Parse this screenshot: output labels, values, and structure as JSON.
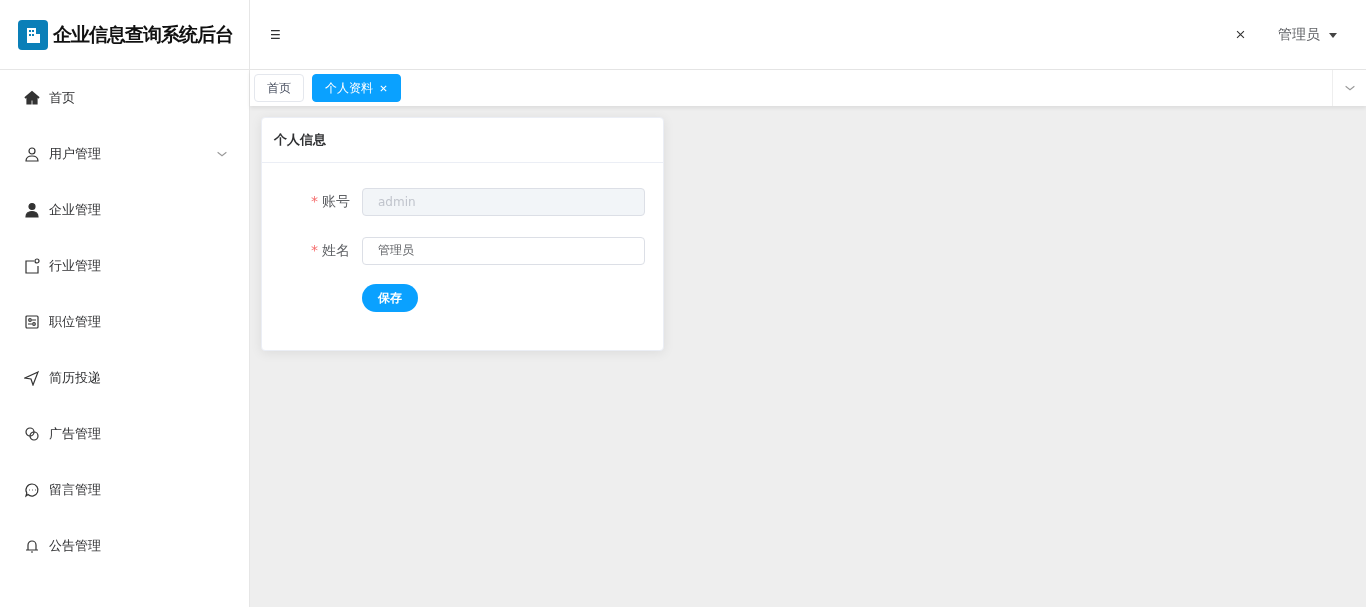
{
  "brand": {
    "title": "企业信息查询系统后台"
  },
  "header": {
    "menu_toggle": "☰",
    "user": "管理员"
  },
  "sidebar": {
    "items": [
      {
        "label": "首页",
        "kind": "link"
      },
      {
        "label": "用户管理",
        "kind": "group"
      },
      {
        "label": "企业管理",
        "kind": "link"
      },
      {
        "label": "行业管理",
        "kind": "link"
      },
      {
        "label": "职位管理",
        "kind": "link"
      },
      {
        "label": "简历投递",
        "kind": "link"
      },
      {
        "label": "广告管理",
        "kind": "link"
      },
      {
        "label": "留言管理",
        "kind": "link"
      },
      {
        "label": "公告管理",
        "kind": "link"
      }
    ]
  },
  "tabs": [
    {
      "label": "首页",
      "selected": false,
      "closable": false
    },
    {
      "label": "个人资料",
      "selected": true,
      "closable": true
    }
  ],
  "card": {
    "title": "个人信息",
    "fields": [
      {
        "label": "账号",
        "required_mark": "*",
        "value": "admin",
        "disabled": true
      },
      {
        "label": "姓名",
        "required_mark": "*",
        "value": "管理员",
        "disabled": false
      }
    ],
    "button": "保存"
  }
}
